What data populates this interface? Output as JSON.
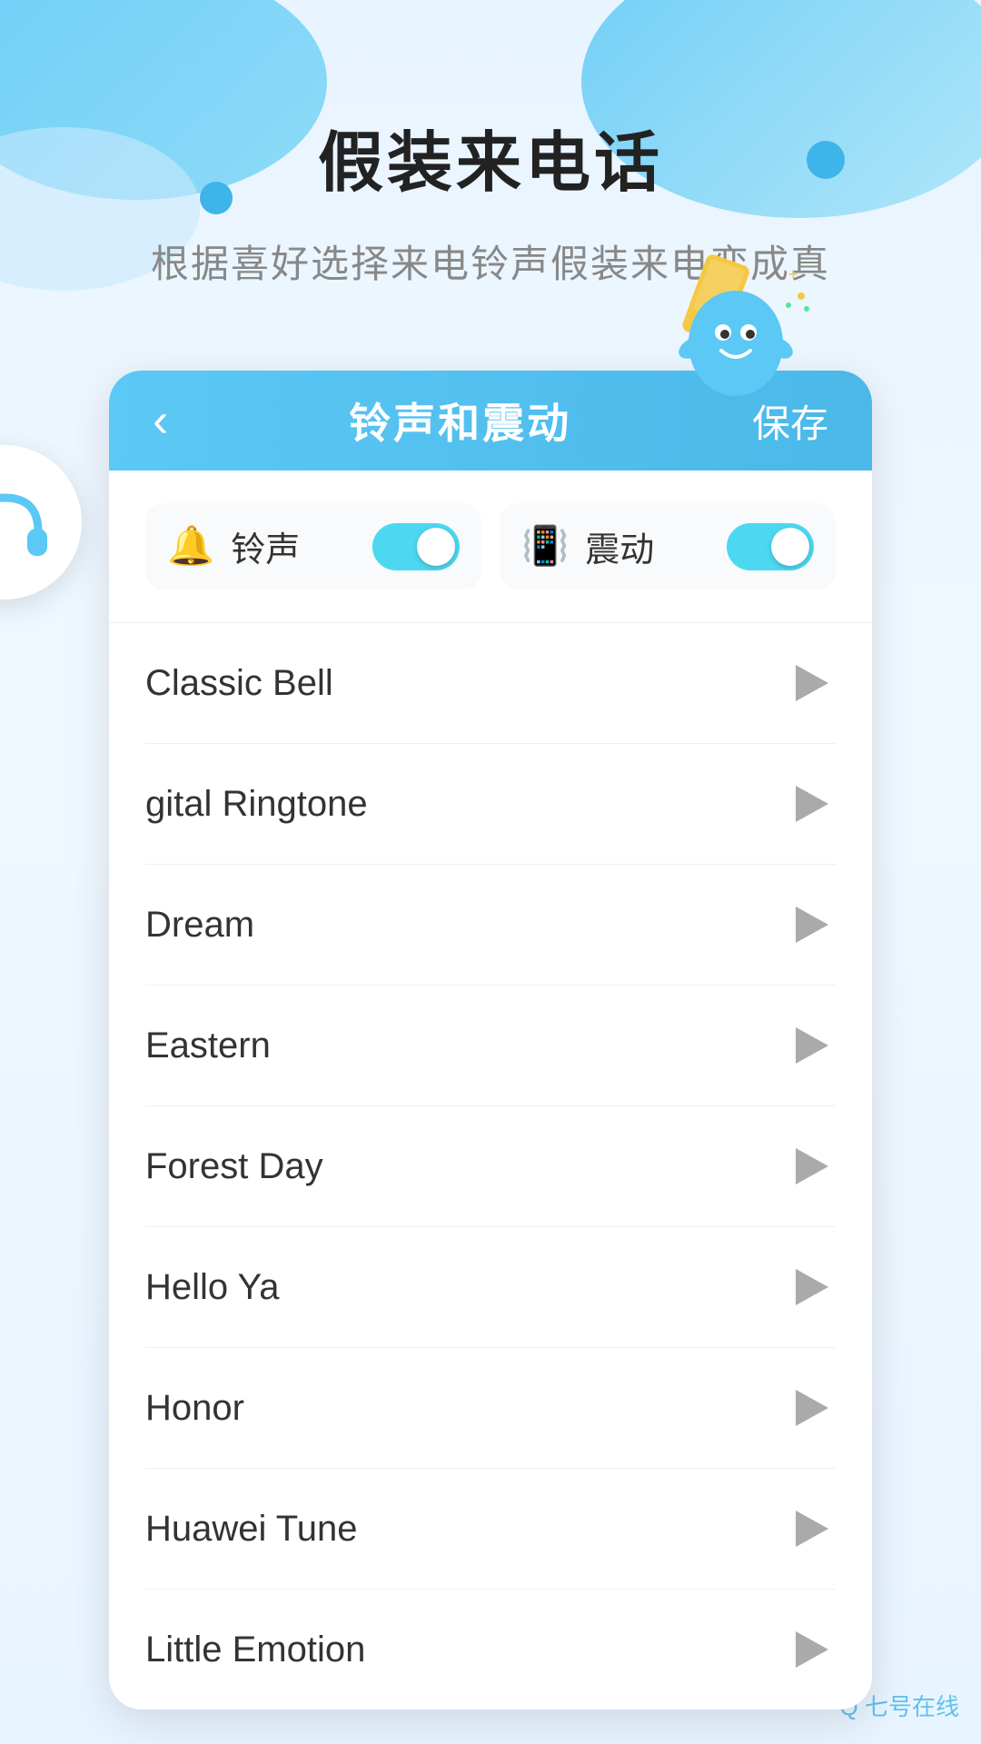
{
  "page": {
    "title": "假装来电话",
    "subtitle": "根据喜好选择来电铃声假装来电变成真",
    "watermark": "Q 七号在线"
  },
  "header": {
    "back_icon": "‹",
    "title": "铃声和震动",
    "save_label": "保存"
  },
  "toggles": {
    "ringtone": {
      "label": "铃声",
      "enabled": true
    },
    "vibration": {
      "label": "震动",
      "enabled": true
    }
  },
  "ringtones": [
    {
      "id": 1,
      "name": "Classic Bell"
    },
    {
      "id": 2,
      "name": "gital Ringtone"
    },
    {
      "id": 3,
      "name": "Dream"
    },
    {
      "id": 4,
      "name": "Eastern"
    },
    {
      "id": 5,
      "name": "Forest Day"
    },
    {
      "id": 6,
      "name": "Hello Ya"
    },
    {
      "id": 7,
      "name": "Honor"
    },
    {
      "id": 8,
      "name": "Huawei Tune"
    },
    {
      "id": 9,
      "name": "Little Emotion"
    }
  ],
  "colors": {
    "accent": "#4bc8f0",
    "header_bg": "#5bc8f5",
    "play_icon": "#aaaaaa"
  }
}
